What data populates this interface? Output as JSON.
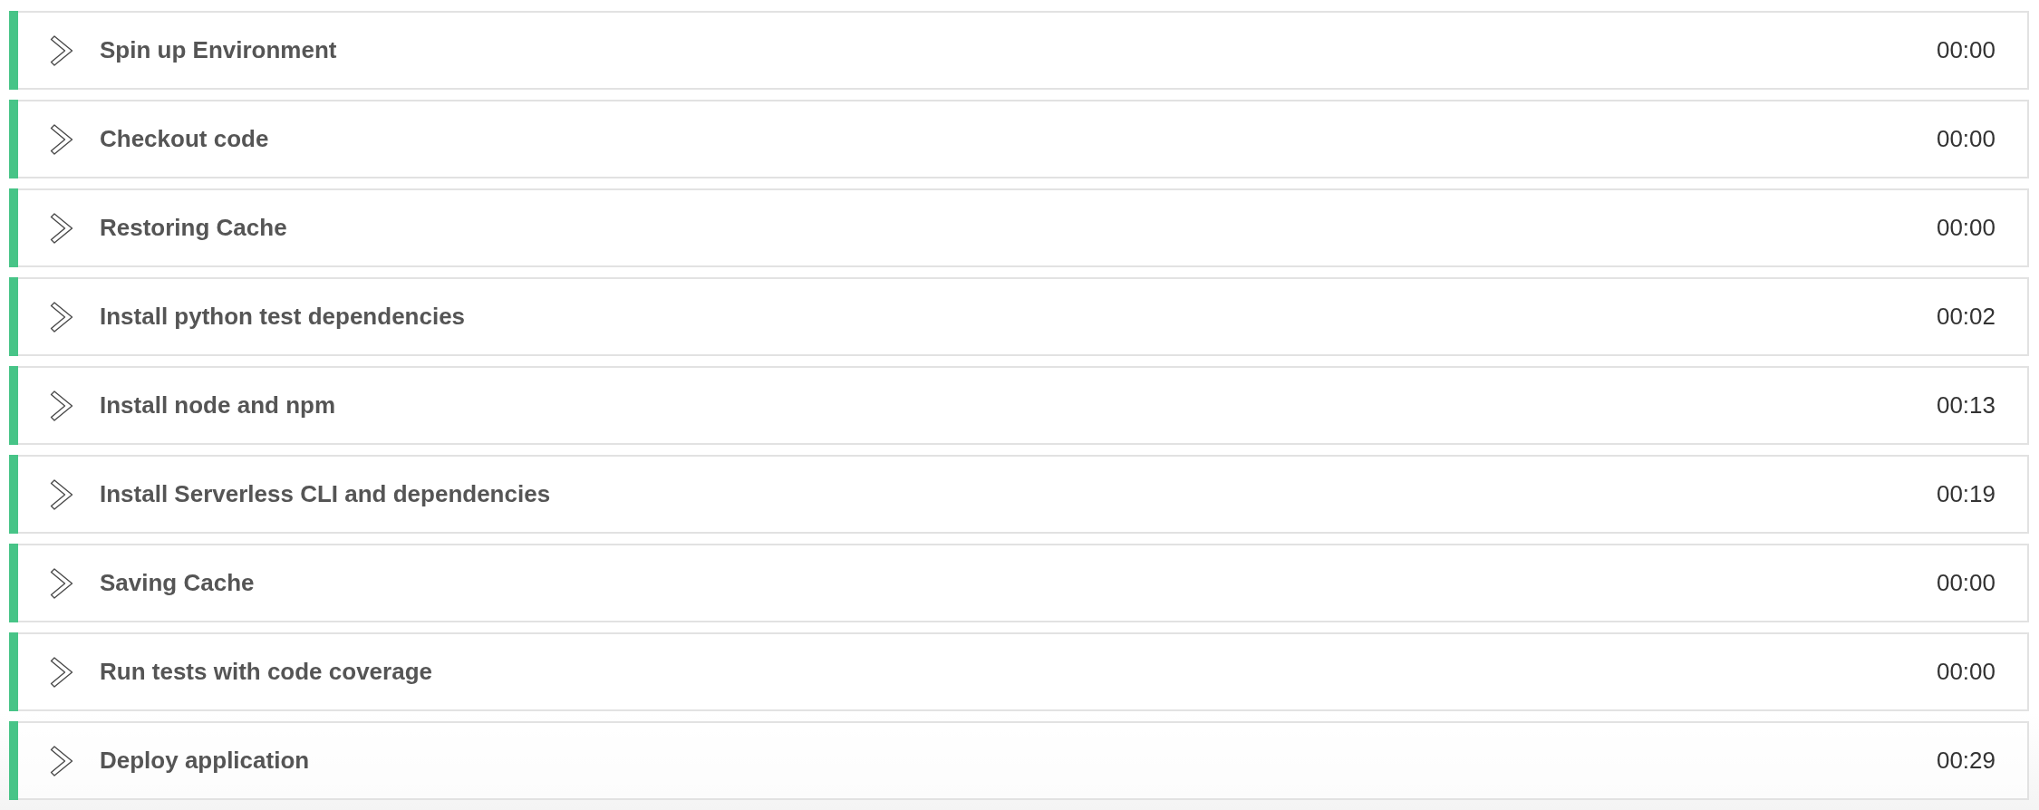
{
  "steps": [
    {
      "name": "Spin up Environment",
      "duration": "00:00",
      "passed": true,
      "expanded": false
    },
    {
      "name": "Checkout code",
      "duration": "00:00",
      "passed": true,
      "expanded": false
    },
    {
      "name": "Restoring Cache",
      "duration": "00:00",
      "passed": true,
      "expanded": false
    },
    {
      "name": "Install python test dependencies",
      "duration": "00:02",
      "passed": true,
      "expanded": false
    },
    {
      "name": "Install node and npm",
      "duration": "00:13",
      "passed": true,
      "expanded": false
    },
    {
      "name": "Install Serverless CLI and dependencies",
      "duration": "00:19",
      "passed": true,
      "expanded": false
    },
    {
      "name": "Saving Cache",
      "duration": "00:00",
      "passed": true,
      "expanded": false
    },
    {
      "name": "Run tests with code coverage",
      "duration": "00:00",
      "passed": true,
      "expanded": false
    },
    {
      "name": "Deploy application",
      "duration": "00:29",
      "passed": true,
      "expanded": false
    }
  ]
}
